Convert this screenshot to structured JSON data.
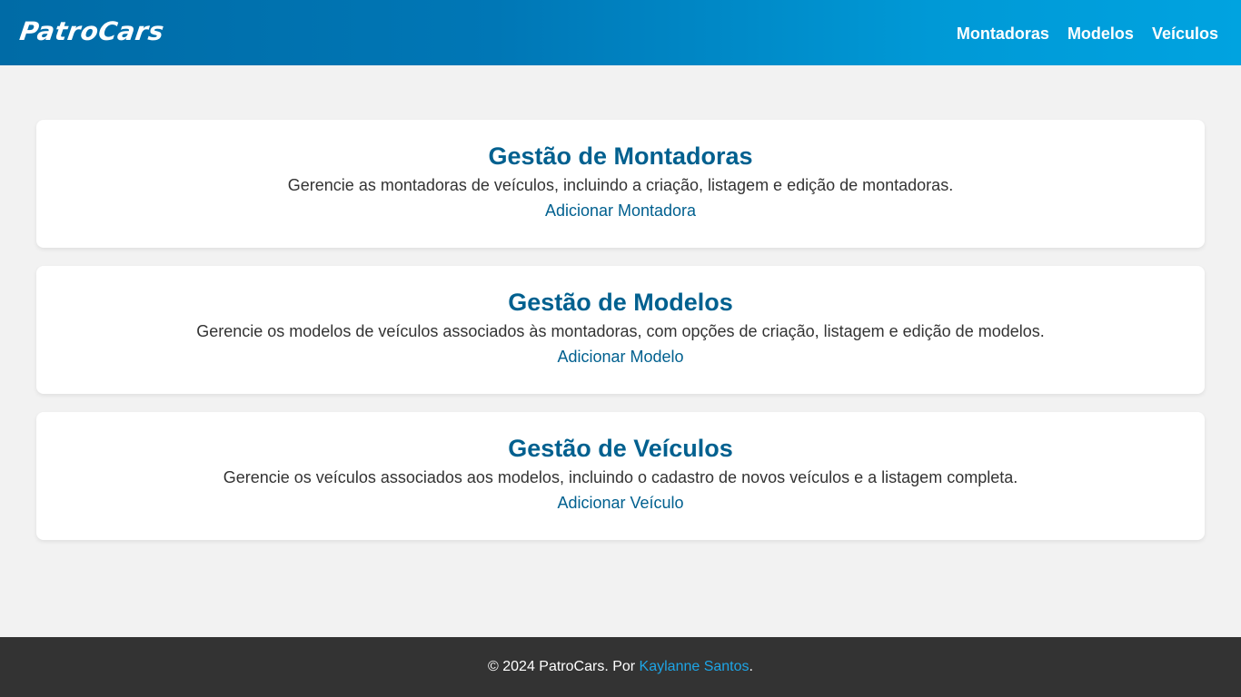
{
  "header": {
    "logo": "PatroCars",
    "nav": [
      "Montadoras",
      "Modelos",
      "Veículos"
    ]
  },
  "cards": [
    {
      "title": "Gestão de Montadoras",
      "description": "Gerencie as montadoras de veículos, incluindo a criação, listagem e edição de montadoras.",
      "link": "Adicionar Montadora"
    },
    {
      "title": "Gestão de Modelos",
      "description": "Gerencie os modelos de veículos associados às montadoras, com opções de criação, listagem e edição de modelos.",
      "link": "Adicionar Modelo"
    },
    {
      "title": "Gestão de Veículos",
      "description": "Gerencie os veículos associados aos modelos, incluindo o cadastro de novos veículos e a listagem completa.",
      "link": "Adicionar Veículo"
    }
  ],
  "footer": {
    "prefix": "© 2024 PatroCars. Por ",
    "author": "Kaylanne Santos",
    "suffix": "."
  },
  "colors": {
    "header_gradient_start": "#006ba6",
    "header_gradient_end": "#00a3e0",
    "accent_title": "#00608f",
    "footer_bg": "#333333",
    "footer_link": "#1ea5e6",
    "page_bg": "#f2f2f2"
  }
}
